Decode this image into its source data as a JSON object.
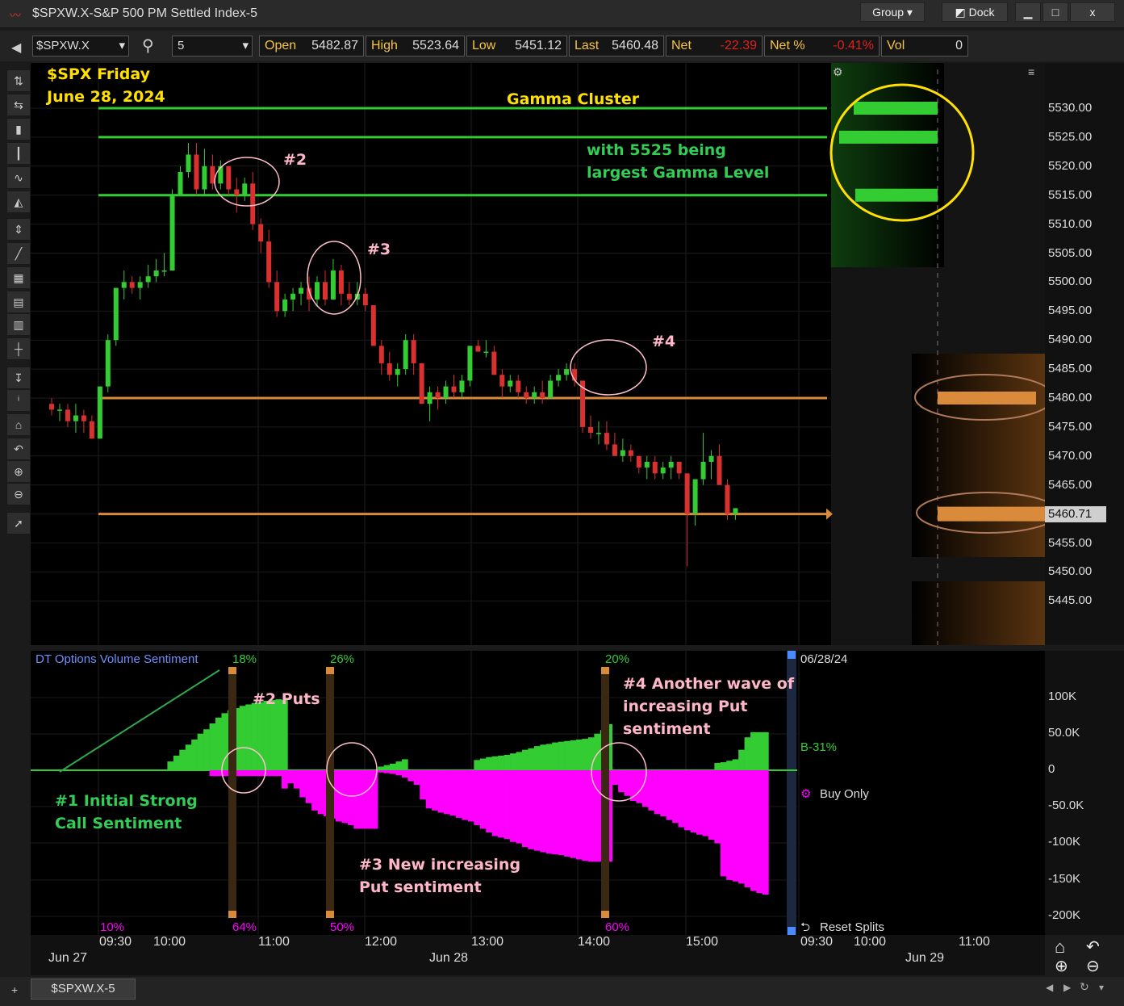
{
  "window": {
    "title": "$SPXW.X-S&P 500 PM Settled Index-5",
    "group_label": "Group",
    "dock_label": "Dock",
    "minimize": "▁",
    "maximize": "□",
    "close": "x"
  },
  "toolbar": {
    "symbol": "$SPXW.X",
    "interval": "5",
    "quotes": [
      {
        "label": "Open",
        "value": "5482.87",
        "color": "#dddddd"
      },
      {
        "label": "High",
        "value": "5523.64",
        "color": "#dddddd"
      },
      {
        "label": "Low",
        "value": "5451.12",
        "color": "#dddddd"
      },
      {
        "label": "Last",
        "value": "5460.48",
        "color": "#dddddd"
      },
      {
        "label": "Net",
        "value": "-22.39",
        "color": "#e02020"
      },
      {
        "label": "Net %",
        "value": "-0.41%",
        "color": "#e02020"
      },
      {
        "label": "Vol",
        "value": "0",
        "color": "#dddddd"
      }
    ]
  },
  "colors": {
    "up": "#33cc33",
    "down": "#d93030",
    "gamma_line": "#33cc33",
    "orange_line": "#d98a3a",
    "annotation_yellow": "#ffe000",
    "annotation_green": "#33cc55",
    "annotation_pink": "#ffb6c8",
    "magenta": "#ff00ff"
  },
  "annotations": {
    "chart_title_1": "$SPX Friday",
    "chart_title_2": "June 28, 2024",
    "gamma_cluster": "Gamma Cluster",
    "gamma_note_1": "with 5525 being",
    "gamma_note_2": "largest Gamma Level",
    "m2": "#2",
    "m3": "#3",
    "m4": "#4",
    "s1_line1": "#1 Initial Strong",
    "s1_line2": "Call Sentiment",
    "s2": "#2 Puts",
    "s3_line1": "#3 New increasing",
    "s3_line2": "Put sentiment",
    "s4_line1": "#4 Another wave of",
    "s4_line2": "increasing Put",
    "s4_line3": "sentiment"
  },
  "sentiment_panel": {
    "title": "DT Options Volume Sentiment",
    "date": "06/28/24",
    "b_label": "B-31%",
    "buy_only": "Buy Only",
    "reset_splits": "Reset Splits",
    "pct_top": [
      "18%",
      "26%",
      "20%"
    ],
    "pct_bottom": [
      "10%",
      "64%",
      "50%",
      "60%"
    ]
  },
  "chart_data": [
    {
      "type": "candlestick",
      "title": "$SPXW.X-S&P 500 PM Settled Index-5",
      "y_ticks": [
        "5530.00",
        "5525.00",
        "5520.00",
        "5515.00",
        "5510.00",
        "5505.00",
        "5500.00",
        "5495.00",
        "5490.00",
        "5485.00",
        "5480.00",
        "5475.00",
        "5470.00",
        "5465.00",
        "5460.00",
        "5455.00",
        "5450.00",
        "5445.00"
      ],
      "ylim": [
        5440,
        5535
      ],
      "last_price_label": "5460.71",
      "gamma_levels": [
        5530,
        5525,
        5515
      ],
      "orange_levels": [
        5480,
        5460
      ],
      "candles": [
        [
          5479,
          5480,
          5477,
          5478
        ],
        [
          5478,
          5479,
          5476,
          5478
        ],
        [
          5478,
          5479,
          5475,
          5476
        ],
        [
          5476,
          5479,
          5474,
          5477
        ],
        [
          5477,
          5478,
          5474,
          5476
        ],
        [
          5476,
          5477,
          5473,
          5473
        ],
        [
          5473,
          5482,
          5473,
          5482
        ],
        [
          5482,
          5491,
          5481,
          5490
        ],
        [
          5490,
          5499,
          5489,
          5499
        ],
        [
          5499,
          5502,
          5497,
          5500
        ],
        [
          5500,
          5501,
          5498,
          5499
        ],
        [
          5499,
          5501,
          5497,
          5500
        ],
        [
          5500,
          5503,
          5499,
          5501
        ],
        [
          5501,
          5504,
          5500,
          5502
        ],
        [
          5502,
          5505,
          5501,
          5502
        ],
        [
          5502,
          5516,
          5502,
          5515
        ],
        [
          5515,
          5520,
          5515,
          5519
        ],
        [
          5519,
          5524,
          5518,
          5522
        ],
        [
          5522,
          5524,
          5515,
          5516
        ],
        [
          5516,
          5523,
          5515,
          5520
        ],
        [
          5520,
          5522,
          5516,
          5517
        ],
        [
          5517,
          5521,
          5516,
          5520
        ],
        [
          5520,
          5520,
          5515,
          5516
        ],
        [
          5516,
          5518,
          5512,
          5515
        ],
        [
          5515,
          5518,
          5514,
          5517
        ],
        [
          5517,
          5519,
          5509,
          5510
        ],
        [
          5510,
          5511,
          5505,
          5507
        ],
        [
          5507,
          5509,
          5499,
          5500
        ],
        [
          5500,
          5502,
          5494,
          5495
        ],
        [
          5495,
          5498,
          5494,
          5497
        ],
        [
          5497,
          5499,
          5495,
          5498
        ],
        [
          5498,
          5500,
          5496,
          5499
        ],
        [
          5499,
          5501,
          5495,
          5497
        ],
        [
          5497,
          5501,
          5496,
          5500
        ],
        [
          5500,
          5502,
          5496,
          5497
        ],
        [
          5497,
          5504,
          5497,
          5502
        ],
        [
          5502,
          5503,
          5496,
          5498
        ],
        [
          5498,
          5500,
          5496,
          5497
        ],
        [
          5497,
          5500,
          5496,
          5498
        ],
        [
          5498,
          5499,
          5495,
          5496
        ],
        [
          5496,
          5496,
          5489,
          5489
        ],
        [
          5489,
          5490,
          5484,
          5486
        ],
        [
          5486,
          5488,
          5483,
          5484
        ],
        [
          5484,
          5486,
          5482,
          5485
        ],
        [
          5485,
          5491,
          5484,
          5490
        ],
        [
          5490,
          5491,
          5484,
          5486
        ],
        [
          5486,
          5486,
          5479,
          5479
        ],
        [
          5479,
          5482,
          5476,
          5481
        ],
        [
          5481,
          5482,
          5478,
          5480
        ],
        [
          5480,
          5483,
          5479,
          5482
        ],
        [
          5482,
          5484,
          5480,
          5481
        ],
        [
          5481,
          5484,
          5480,
          5483
        ],
        [
          5483,
          5489,
          5482,
          5489
        ],
        [
          5489,
          5490,
          5488,
          5488
        ],
        [
          5488,
          5490,
          5487,
          5488
        ],
        [
          5488,
          5489,
          5484,
          5484
        ],
        [
          5484,
          5485,
          5480,
          5482
        ],
        [
          5482,
          5484,
          5481,
          5483
        ],
        [
          5483,
          5484,
          5480,
          5481
        ],
        [
          5481,
          5482,
          5479,
          5480
        ],
        [
          5480,
          5482,
          5479,
          5481
        ],
        [
          5481,
          5483,
          5479,
          5480
        ],
        [
          5480,
          5484,
          5480,
          5483
        ],
        [
          5483,
          5485,
          5482,
          5484
        ],
        [
          5484,
          5486,
          5483,
          5485
        ],
        [
          5485,
          5486,
          5482,
          5483
        ],
        [
          5483,
          5483,
          5474,
          5475
        ],
        [
          5475,
          5477,
          5473,
          5474
        ],
        [
          5474,
          5476,
          5472,
          5474
        ],
        [
          5474,
          5476,
          5471,
          5472
        ],
        [
          5472,
          5474,
          5470,
          5470
        ],
        [
          5470,
          5473,
          5469,
          5471
        ],
        [
          5471,
          5472,
          5469,
          5470
        ],
        [
          5470,
          5470,
          5467,
          5468
        ],
        [
          5468,
          5470,
          5466,
          5469
        ],
        [
          5469,
          5470,
          5466,
          5467
        ],
        [
          5467,
          5469,
          5466,
          5468
        ],
        [
          5468,
          5470,
          5466,
          5469
        ],
        [
          5469,
          5469,
          5466,
          5467
        ],
        [
          5467,
          5467,
          5451,
          5460
        ],
        [
          5460,
          5466,
          5458,
          5466
        ],
        [
          5466,
          5474,
          5465,
          5469
        ],
        [
          5469,
          5471,
          5466,
          5470
        ],
        [
          5470,
          5472,
          5466,
          5465
        ],
        [
          5465,
          5466,
          5459,
          5460
        ],
        [
          5460,
          5461,
          5459,
          5461
        ]
      ]
    },
    {
      "type": "bar",
      "title": "DT Options Volume Sentiment",
      "y_ticks": [
        "100K",
        "50.0K",
        "0",
        "-50.0K",
        "-100K",
        "-150K",
        "-200K"
      ],
      "ylim": [
        -200000,
        135000
      ],
      "x_ticks": [
        "09:30",
        "10:00",
        "11:00",
        "12:00",
        "13:00",
        "14:00",
        "15:00",
        "09:30",
        "10:00",
        "11:00"
      ],
      "date_labels": [
        "Jun 27",
        "Jun 28",
        "Jun 29"
      ],
      "series": [
        {
          "name": "Call",
          "values": [
            0,
            0,
            0,
            0,
            0,
            0,
            0,
            0,
            0,
            0,
            0,
            0,
            12000,
            20000,
            28000,
            35000,
            42000,
            50000,
            56000,
            64000,
            72000,
            78000,
            82000,
            85000,
            88000,
            90000,
            92000,
            93000,
            95000,
            96000,
            97000,
            96000,
            0,
            0,
            0,
            0,
            0,
            0,
            0,
            0,
            0,
            0,
            0,
            0,
            0,
            0,
            0,
            5000,
            7000,
            9000,
            12000,
            15000,
            0,
            0,
            0,
            0,
            0,
            0,
            0,
            0,
            0,
            0,
            0,
            14000,
            16000,
            18000,
            19000,
            20000,
            21000,
            23000,
            25000,
            28000,
            30000,
            33000,
            35000,
            36000,
            38000,
            39000,
            40000,
            41000,
            42000,
            43000,
            45000,
            50000,
            55000,
            63000,
            0,
            0,
            0,
            0,
            0,
            0,
            0,
            0,
            0,
            0,
            0,
            0,
            0,
            0,
            0,
            0,
            0,
            10000,
            11000,
            13000,
            15000,
            28000,
            45000,
            52000,
            52000,
            52000
          ]
        },
        {
          "name": "Put",
          "values": [
            0,
            0,
            0,
            0,
            0,
            0,
            0,
            0,
            0,
            0,
            0,
            0,
            0,
            0,
            0,
            0,
            0,
            0,
            0,
            -8000,
            -8000,
            -8000,
            -8000,
            -8000,
            -8000,
            -8000,
            -8000,
            -8000,
            -8000,
            -8000,
            -8000,
            -25000,
            -18000,
            -25000,
            -37000,
            -45000,
            -55000,
            -60000,
            -63000,
            -66000,
            -70000,
            -72000,
            -75000,
            -80000,
            -80000,
            -80000,
            -80000,
            -3000,
            -4000,
            -5000,
            -7000,
            -10000,
            -15000,
            -20000,
            -40000,
            -52000,
            -55000,
            -58000,
            -60000,
            -62000,
            -65000,
            -68000,
            -70000,
            -75000,
            -80000,
            -85000,
            -90000,
            -92000,
            -94000,
            -98000,
            -100000,
            -105000,
            -108000,
            -110000,
            -112000,
            -114000,
            -115000,
            -116000,
            -118000,
            -120000,
            -122000,
            -124000,
            -125000,
            -125000,
            -125000,
            -125000,
            -20000,
            -30000,
            -35000,
            -42000,
            -45000,
            -50000,
            -55000,
            -60000,
            -63000,
            -68000,
            -72000,
            -78000,
            -82000,
            -85000,
            -88000,
            -90000,
            -95000,
            -100000,
            -145000,
            -150000,
            -152000,
            -155000,
            -160000,
            -165000,
            -168000,
            -170000
          ]
        }
      ]
    }
  ],
  "status": {
    "tab": "$SPXW.X-5"
  },
  "icons": {
    "search": "search-icon",
    "home": "home-icon",
    "zoom_in": "zoom-in-icon",
    "zoom_out": "zoom-out-icon",
    "undo": "undo-icon"
  }
}
